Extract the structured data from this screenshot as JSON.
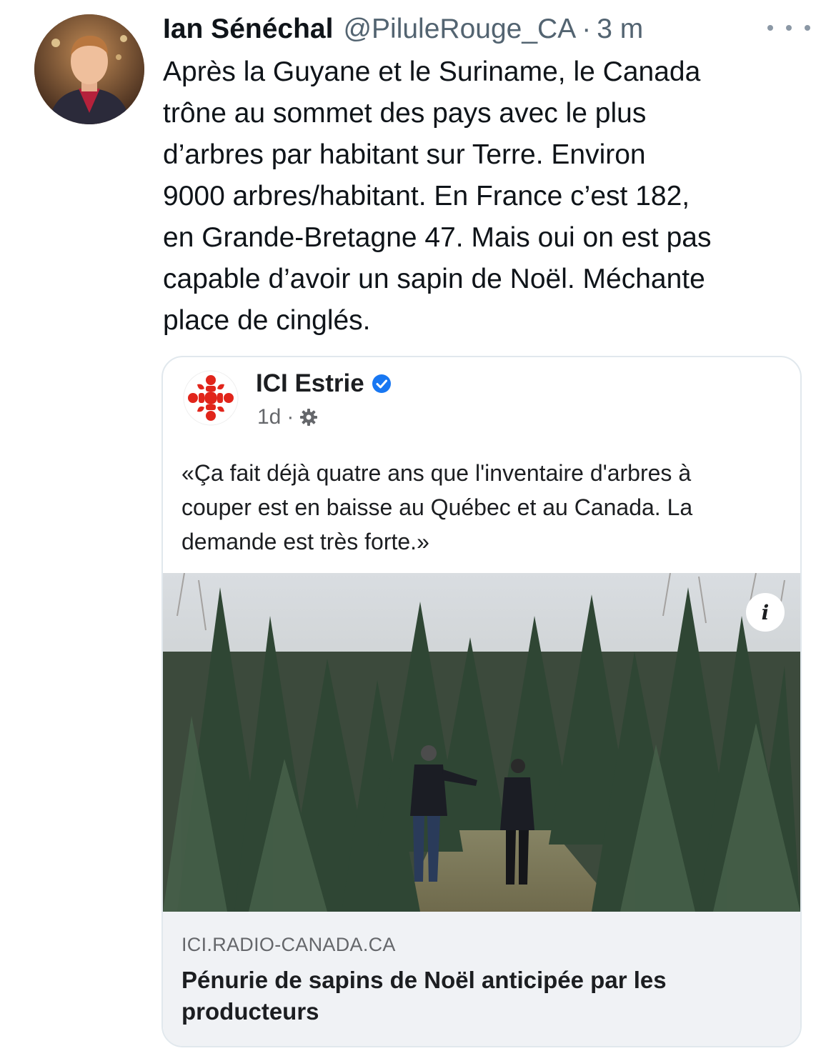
{
  "tweet": {
    "author_name": "Ian Sénéchal",
    "handle": "@PiluleRouge_CA",
    "separator": "·",
    "time": "3 m",
    "text_lines": [
      "Après la Guyane et le Suriname, le Canada",
      "trône au sommet des pays avec le plus",
      "d’arbres par habitant sur Terre. Environ",
      "9000 arbres/habitant. En France c’est 182,",
      "en Grande-Bretagne 47. Mais oui on est pas",
      "capable d’avoir un sapin de Noël. Méchante",
      "place de cinglés."
    ],
    "more_icon": "more-horizontal-icon"
  },
  "shared_post": {
    "source_name": "ICI Estrie",
    "verified_icon": "verified-badge-icon",
    "age": "1d",
    "separator": "·",
    "audience_icon": "gear-icon",
    "quote_lines": [
      "«Ça fait déjà quatre ans que l'inventaire d'arbres à",
      "couper est en baisse au Québec et au Canada. La",
      "demande est très forte.»"
    ],
    "photo_icon": "info-icon",
    "info_label": "i",
    "link": {
      "domain": "ICI.RADIO-CANADA.CA",
      "headline_lines": [
        "Pénurie de sapins de Noël anticipée par les",
        "producteurs"
      ]
    }
  },
  "colors": {
    "brand_red": "#e1251b",
    "verified_blue": "#1877f2",
    "secondary_text": "#536471",
    "link_box_bg": "#f0f2f5"
  }
}
